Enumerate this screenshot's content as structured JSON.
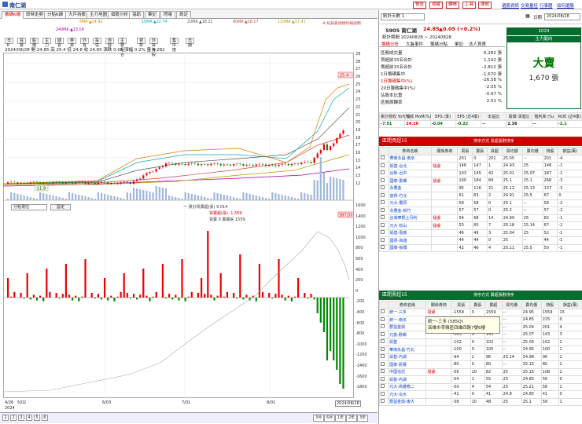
{
  "window": {
    "title": "南仁湖"
  },
  "top_buttons": [
    "警告",
    "收藏",
    "轉帳",
    "工具",
    "導航"
  ],
  "top_links": [
    "選股資訊",
    "交易量佳",
    "行事曆",
    "如何選股"
  ],
  "main_tabs": [
    "籌碼K線",
    "即時走勢",
    "分點K線",
    "大戶持股",
    "主力地圖",
    "個股分析",
    "協助",
    "筆記",
    "閃電",
    "設定"
  ],
  "ma_legend": [
    {
      "label": "5MA ▲24.42",
      "color": "#e57a00"
    },
    {
      "label": "10MA ▲22.74",
      "color": "#1aa"
    },
    {
      "label": "20MA ▲18.21",
      "color": "#555"
    },
    {
      "label": "60MA ▲18.17",
      "color": "#c44"
    },
    {
      "label": "120MA ▲17.41",
      "color": "#b59a00"
    },
    {
      "label": "240MA ▲13.14",
      "color": "#a0a"
    }
  ],
  "legend_note": "※ 紀錄各指標均線說明",
  "period_tabs": [
    "日K",
    "買賣",
    "股價",
    "主力",
    "期貨",
    "券資",
    "外資",
    "投信",
    "自營",
    "主要組合",
    "貸款",
    "外資持股",
    "集中度",
    "日期"
  ],
  "info_line": "2024/08/28  開 24.85  高 25.4  低 24.8  收 24.85  漲跌 0.05  漲幅 0.2%  量 6,282",
  "price_axis": [
    "29",
    "28",
    "27",
    "26",
    "25",
    "24",
    "23",
    "22",
    "21",
    "20",
    "19",
    "18",
    "17",
    "16",
    "15",
    "14",
    "13",
    "12"
  ],
  "price_tag": "25.4",
  "low_tag": "11.9",
  "sub_dropdown": "分點選估",
  "sub_setting": "設定",
  "sub_title": "一 累計買賣超(張) 5,014",
  "sub_info1": "買賣超(張) -1,559",
  "sub_info2": "買賣 0  賣賣張 1559",
  "sub_axis": [
    "1600",
    "1400",
    "1200",
    "1000",
    "800",
    "600",
    "400",
    "200",
    "0",
    "-200",
    "-400",
    "-600",
    "-800",
    "-1000",
    "-1200",
    "-1400",
    "-1600",
    "-1800"
  ],
  "sub_tag": "38720",
  "date_axis": [
    "4/26",
    "5/02",
    "6/03",
    "7/01",
    "8/01"
  ],
  "date_year": "2024",
  "date_current": "2024/08/28",
  "bottom_nums": [
    "1",
    "2",
    "3",
    "4",
    "5",
    "6"
  ],
  "period_buttons": [
    "3月",
    "6月",
    "1年",
    "2年",
    "3年"
  ],
  "rp": {
    "stats_dropdown": "統計天數  1",
    "date_label": "日期",
    "date_value": "2024/08/28",
    "stock": "5905 南仁湖",
    "stock_price": "24.85",
    "stock_change": "▲0.05 (+0.2%)",
    "range": "統計期間  20240828 ~ 20240828",
    "tabs": [
      "籌碼分析",
      "大盤事件",
      "籌碼分點",
      "筆記",
      "法人買賣"
    ],
    "stats": [
      {
        "k": "區間成交量",
        "v": "6,282 張"
      },
      {
        "k": "買超前15名合計",
        "v": "1,142 張"
      },
      {
        "k": "賣超前15名合計",
        "v": "-2,812 張"
      },
      {
        "k": "1日籌碼集中",
        "v": "-1,670 張"
      },
      {
        "k": "1日籌碼集中(%)",
        "v": "-26.58 %"
      },
      {
        "k": "20日籌碼集中(%)",
        "v": "-2.05 %"
      },
      {
        "k": "佔股本比重",
        "v": "-0.67 %"
      },
      {
        "k": "區間周轉率",
        "v": "2.51 %"
      }
    ],
    "year_label": "2024",
    "main_force_label": "主力動向",
    "main_force_value": "大賣",
    "main_force_qty": "1,670 張",
    "fin_headers": [
      "累計營收 YoY(%)",
      "營收 MoM(%)",
      "EPS (季)",
      "EPS (近4季)",
      "本益比",
      "股價 淨值比",
      "殖利率 (%)",
      "ROE (近4季)"
    ],
    "fin_values": [
      "-7.51",
      "24.16",
      "-0.04",
      "-0.22",
      "--",
      "2.36",
      "--",
      "-2.1"
    ],
    "buy_title": "區間買超15",
    "buy_sort": "排序方式 買超張數排序",
    "buy_headers": [
      "",
      "券商名稱",
      "關係券商",
      "買張",
      "賣張",
      "買超",
      "買均價",
      "賣均價",
      "持股",
      "損益(萬)"
    ],
    "buy_rows": [
      [
        "華南永昌-南京",
        "",
        "201",
        "0",
        "201",
        "25.05",
        "--",
        "201",
        "-4"
      ],
      [
        "凱基-台北",
        "疑慮",
        "146",
        "147",
        "1",
        "24.93",
        "25",
        "148",
        "-1"
      ],
      [
        "台新-台中",
        "",
        "103",
        "145",
        "42",
        "25.01",
        "25.07",
        "187",
        "-1"
      ],
      [
        "國泰-歡鄉",
        "疑慮",
        "100",
        "184",
        "84",
        "25.1",
        "25.1",
        "268",
        "-3"
      ],
      [
        "永豐金",
        "",
        "95",
        "116",
        "21",
        "25.12",
        "25.13",
        "137",
        "-3"
      ],
      [
        "富邦-竹北",
        "",
        "61",
        "63",
        "2",
        "24.91",
        "25.5",
        "67",
        "0"
      ],
      [
        "元大-豐原",
        "",
        "58",
        "58",
        "0",
        "25.1",
        "--",
        "58",
        "-2"
      ],
      [
        "永豐金-新竹",
        "",
        "57",
        "57",
        "0",
        "25.2",
        "--",
        "57",
        "-2"
      ],
      [
        "台灣摩根士丹利",
        "疑慮",
        "54",
        "68",
        "14",
        "24.99",
        "25",
        "82",
        "-1"
      ],
      [
        "元大-松山",
        "疑慮",
        "53",
        "60",
        "7",
        "25.18",
        "25.14",
        "67",
        "-2"
      ],
      [
        "凱基-嘉義",
        "",
        "46",
        "49",
        "3",
        "25.04",
        "25",
        "52",
        "-1"
      ],
      [
        "國票-高雄",
        "",
        "44",
        "44",
        "0",
        "25",
        "--",
        "44",
        "-1"
      ],
      [
        "國泰-板橋",
        "",
        "42",
        "46",
        "4",
        "25.11",
        "25.5",
        "50",
        "-1"
      ]
    ],
    "sell_title": "區間賣超15",
    "sell_sort": "排序方式 賣超張數排序",
    "sell_headers": [
      "",
      "券商名稱",
      "關係券商",
      "買張",
      "賣張",
      "賣超",
      "買均價",
      "賣均價",
      "持股",
      "損益(萬)"
    ],
    "sell_rows": [
      [
        "統一-三多",
        "疑慮",
        "-1559",
        "0",
        "1559",
        "--",
        "24.95",
        "1559",
        "15"
      ],
      [
        "統一-南京",
        "",
        "-225",
        "0",
        "225",
        "--",
        "24.85",
        "225",
        "0"
      ],
      [
        "群益金鼎",
        "",
        "-201",
        "0",
        "201",
        "--",
        "25.04",
        "201",
        "4"
      ],
      [
        "元富-歡鄉",
        "",
        "-143",
        "0",
        "143",
        "--",
        "25.07",
        "143",
        "3"
      ],
      [
        "凱基",
        "",
        "-102",
        "0",
        "102",
        "--",
        "25.05",
        "102",
        "2"
      ],
      [
        "華南永昌-竹北",
        "",
        "-100",
        "0",
        "100",
        "--",
        "24.95",
        "100",
        "1"
      ],
      [
        "凱基-內湖",
        "",
        "-94",
        "2",
        "96",
        "25.14",
        "24.98",
        "96",
        "2"
      ],
      [
        "國泰-民權",
        "",
        "-80",
        "0",
        "80",
        "--",
        "25.15",
        "80",
        "2"
      ],
      [
        "中國信託",
        "疑慮",
        "-56",
        "20",
        "82",
        "25",
        "25.15",
        "108",
        "2"
      ],
      [
        "凱基-內湖",
        "",
        "-54",
        "1",
        "55",
        "25",
        "24.85",
        "56",
        "0"
      ],
      [
        "元大-高雄春二",
        "",
        "-50",
        "4",
        "54",
        "25",
        "25.21",
        "58",
        "2"
      ],
      [
        "元大-淡水",
        "",
        "-41",
        "0",
        "41",
        "24.8",
        "24.85",
        "41",
        "0"
      ],
      [
        "群益金鼎-東大",
        "",
        "-38",
        "10",
        "48",
        "25",
        "25.1",
        "58",
        "1"
      ]
    ],
    "tooltip_line1": "統一-三多 (585Q)",
    "tooltip_line2": "高雄市苓雅區四維四路7號6樓"
  }
}
